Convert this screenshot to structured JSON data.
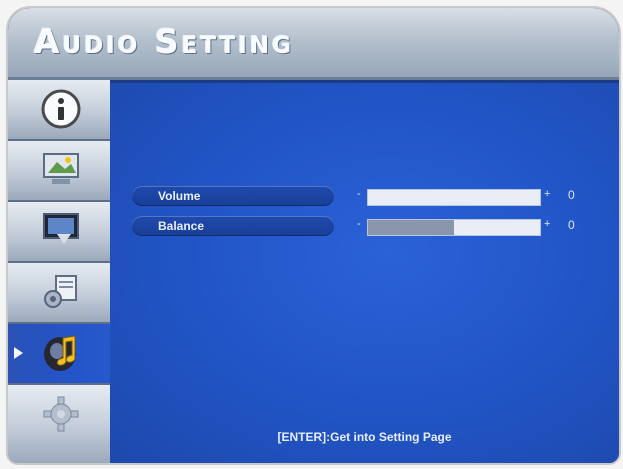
{
  "header": {
    "title": "Audio Setting"
  },
  "sidebar": {
    "items": [
      {
        "icon": "info-icon",
        "selected": false
      },
      {
        "icon": "picture-icon",
        "selected": false
      },
      {
        "icon": "display-icon",
        "selected": false
      },
      {
        "icon": "tools-icon",
        "selected": false
      },
      {
        "icon": "music-note-icon",
        "selected": true
      },
      {
        "icon": "gear-icon",
        "selected": false
      }
    ]
  },
  "settings": {
    "volume": {
      "label": "Volume",
      "minus": "-",
      "plus": "+",
      "value": "0",
      "fill_fraction": 0
    },
    "balance": {
      "label": "Balance",
      "minus": "-",
      "plus": "+",
      "value": "0",
      "fill_fraction": 0.5
    }
  },
  "footer": {
    "hint": "[ENTER]:Get into Setting Page"
  },
  "colors": {
    "panel": "#2155c7",
    "header": "#b3bfcc",
    "accent": "#f8fbff"
  }
}
